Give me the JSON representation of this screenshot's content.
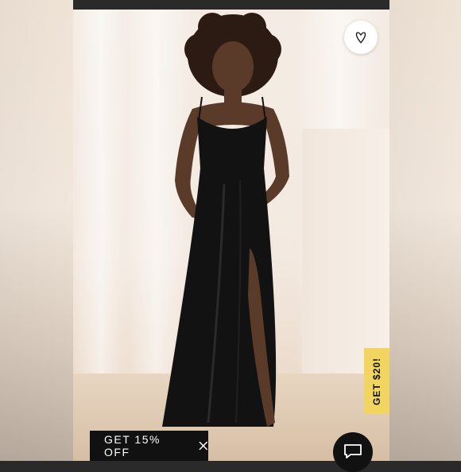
{
  "promo": {
    "label": "GET 15% OFF"
  },
  "side_tab": {
    "label": "GET $20!"
  },
  "colors": {
    "promo_bg": "#111111",
    "tab_bg": "#f1d560",
    "dress": "#121212",
    "skin": "#5a3a28"
  },
  "icons": {
    "favorite": "heart-icon",
    "close": "close-icon",
    "chat": "chat-icon"
  }
}
